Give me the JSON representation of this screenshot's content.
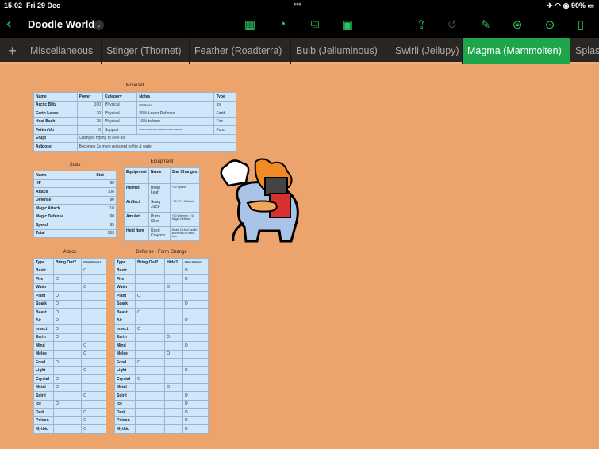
{
  "status": {
    "time": "15:02",
    "date": "Fri 29 Dec",
    "battery": "90%"
  },
  "toolbar": {
    "title": "Doodle World"
  },
  "tabs": [
    "Miscellaneous",
    "Stinger (Thornet)",
    "Feather (Roadterra)",
    "Bulb (Jelluminous)",
    "Swirli (Jellupy)",
    "Magma (Mammolten)",
    "Splas"
  ],
  "moveset": {
    "title": "Moveset",
    "headers": [
      "Name",
      "Power",
      "Category",
      "Notes",
      "Type"
    ],
    "rows": [
      [
        "Arctic Blitz",
        "100",
        "Physical",
        "25% Recoil",
        "Ice"
      ],
      [
        "Earth Lance",
        "70",
        "Physical",
        "20% Lower Defense",
        "Earth"
      ],
      [
        "Heat Bash",
        "75",
        "Physical",
        "10% to burn",
        "Fire"
      ],
      [
        "Fatten Up",
        "0",
        "Support",
        "Boosts Defense, changes trait to Adipose",
        "Food"
      ]
    ],
    "traits": [
      [
        "Erupt",
        "Changes typing to Fire-Ice"
      ],
      [
        "Adipose",
        "Becomes 2x more resistent to fire & water"
      ]
    ]
  },
  "stats": {
    "title": "Stats",
    "headers": [
      "Name",
      "Stat"
    ],
    "rows": [
      [
        "HP",
        "90"
      ],
      [
        "Attack",
        "108"
      ],
      [
        "Defense",
        "90"
      ],
      [
        "Magic Attack",
        "110"
      ],
      [
        "Magic Defense",
        "90"
      ],
      [
        "Speed",
        "95"
      ],
      [
        "Total",
        "583"
      ]
    ]
  },
  "equipment": {
    "title": "Equipment",
    "headers": [
      "Equipment",
      "Name",
      "Stat Changes"
    ],
    "rows": [
      [
        "Helmet",
        "Head Leaf",
        "+10 Speed"
      ],
      [
        "Artifact",
        "Swag Juice",
        "+10 HP, +8 Attack"
      ],
      [
        "Amulet",
        "Pizza Slice",
        "+10 Defense, +10 Magic Defense"
      ],
      [
        "Held Item",
        "Used Crayons",
        "Heals 1/16 of health at the end of each turn"
      ]
    ]
  },
  "attack": {
    "title": "Attack",
    "headers": [
      "Type",
      "Bring Out?",
      "Other Options?"
    ],
    "mark": "O",
    "rows": [
      [
        "Basic",
        2
      ],
      [
        "Fire",
        1
      ],
      [
        "Water",
        2
      ],
      [
        "Plant",
        1
      ],
      [
        "Spark",
        1
      ],
      [
        "Beast",
        1
      ],
      [
        "Air",
        1
      ],
      [
        "Insect",
        1
      ],
      [
        "Earth",
        1
      ],
      [
        "Mind",
        2
      ],
      [
        "Melee",
        2
      ],
      [
        "Food",
        1
      ],
      [
        "Light",
        2
      ],
      [
        "Crystal",
        1
      ],
      [
        "Metal",
        1
      ],
      [
        "Spirit",
        2
      ],
      [
        "Ice",
        1
      ],
      [
        "Dark",
        2
      ],
      [
        "Poison",
        2
      ],
      [
        "Mythic",
        2
      ]
    ]
  },
  "defense": {
    "title": "Defense - Form Change",
    "headers": [
      "Type",
      "Bring Out?",
      "Hide?",
      "Other Options?"
    ],
    "mark": "O",
    "rows": [
      [
        "Basic",
        3
      ],
      [
        "Fire",
        3
      ],
      [
        "Water",
        2
      ],
      [
        "Plant",
        1
      ],
      [
        "Spark",
        3
      ],
      [
        "Beast",
        1
      ],
      [
        "Air",
        3
      ],
      [
        "Insect",
        1
      ],
      [
        "Earth",
        2
      ],
      [
        "Mind",
        3
      ],
      [
        "Melee",
        2
      ],
      [
        "Food",
        1
      ],
      [
        "Light",
        3
      ],
      [
        "Crystal",
        1
      ],
      [
        "Metal",
        2
      ],
      [
        "Spirit",
        3
      ],
      [
        "Ice",
        3
      ],
      [
        "Dark",
        3
      ],
      [
        "Poison",
        3
      ],
      [
        "Mythic",
        3
      ]
    ]
  }
}
